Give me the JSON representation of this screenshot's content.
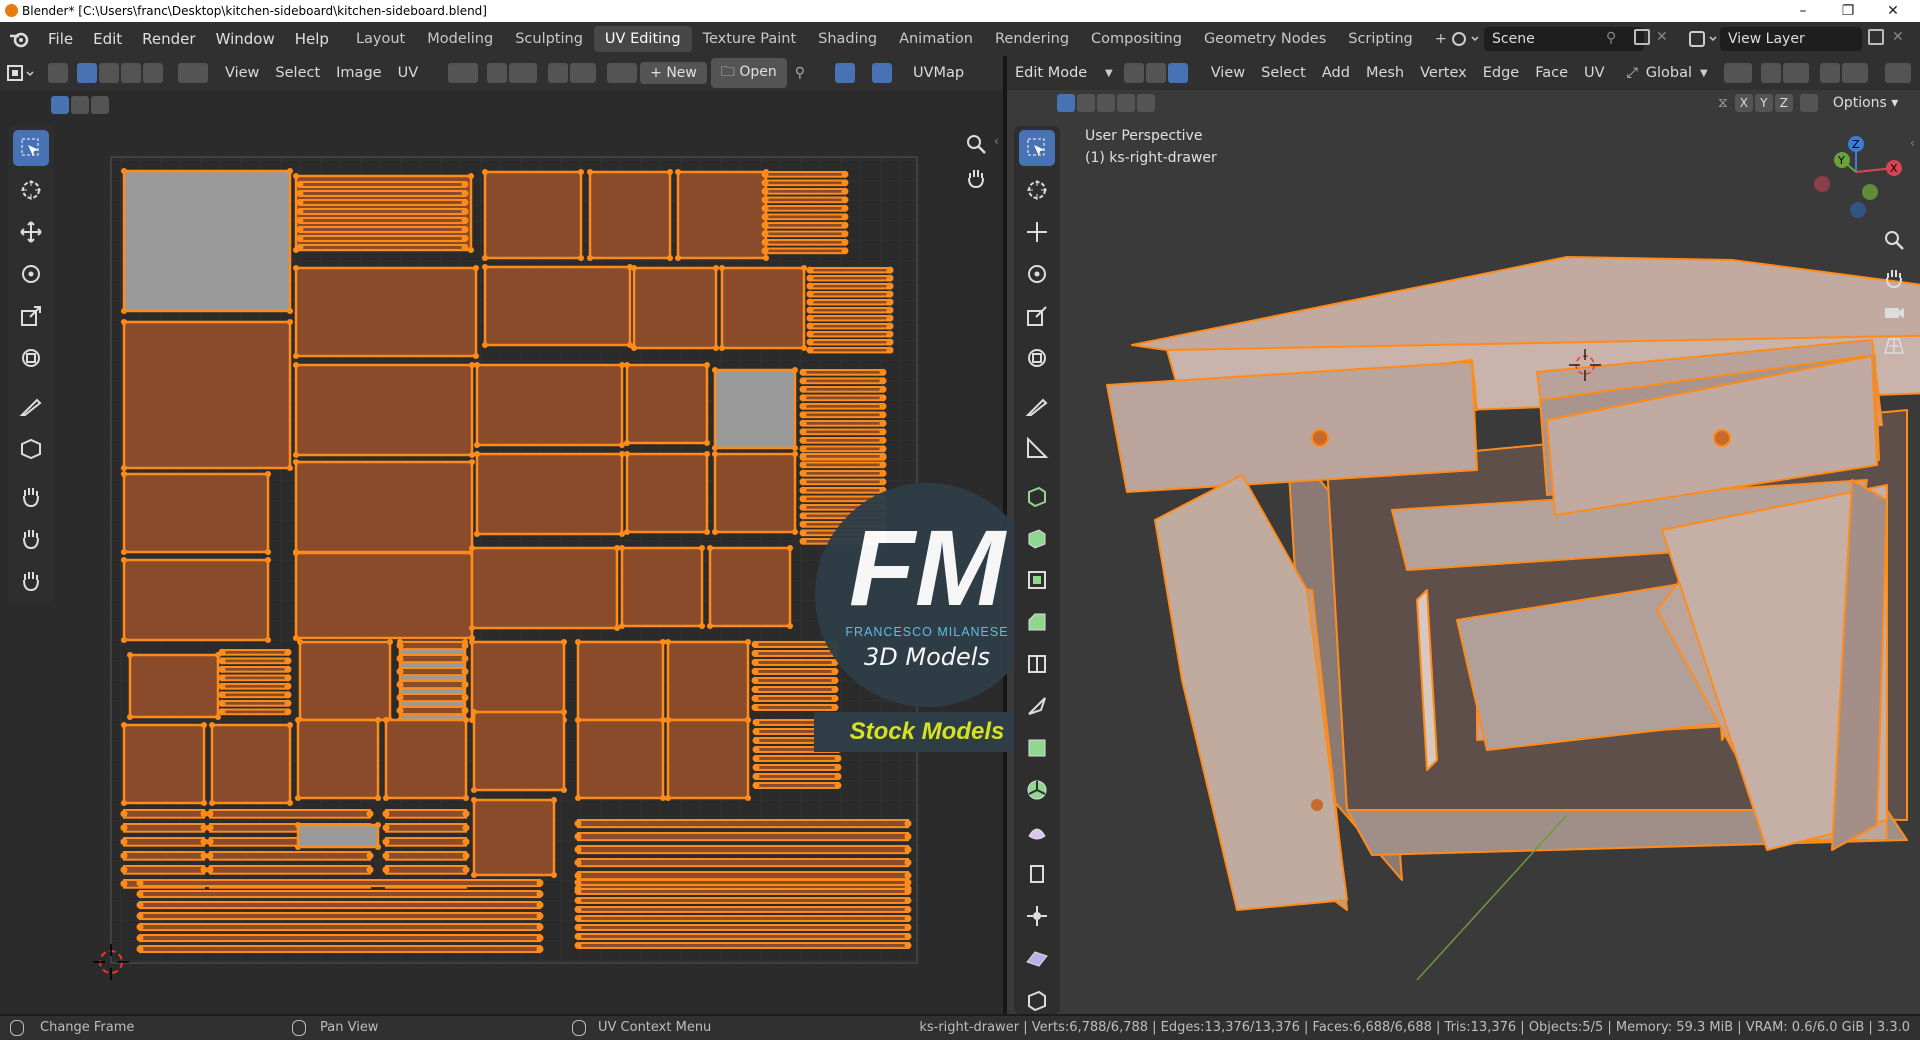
{
  "window": {
    "title": "Blender* [C:\\Users\\franc\\Desktop\\kitchen-sideboard\\kitchen-sideboard.blend]",
    "minimize": "–",
    "maximize": "❐",
    "close": "✕"
  },
  "menu": [
    "File",
    "Edit",
    "Render",
    "Window",
    "Help"
  ],
  "workspaces": [
    "Layout",
    "Modeling",
    "Sculpting",
    "UV Editing",
    "Texture Paint",
    "Shading",
    "Animation",
    "Rendering",
    "Compositing",
    "Geometry Nodes",
    "Scripting"
  ],
  "active_workspace": "UV Editing",
  "scene": {
    "label": "Scene"
  },
  "view_layer": {
    "label": "View Layer"
  },
  "uv_editor": {
    "menus": [
      "View",
      "Select",
      "Image",
      "UV"
    ],
    "new_label": "New",
    "open_label": "Open",
    "uvmap_label": "UVMap"
  },
  "viewport": {
    "mode_label": "Edit Mode",
    "menus": [
      "View",
      "Select",
      "Add",
      "Mesh",
      "Vertex",
      "Edge",
      "Face",
      "UV"
    ],
    "transform_orientation": "Global",
    "axes": [
      "X",
      "Y",
      "Z"
    ],
    "options_label": "Options",
    "overlay_line1": "User Perspective",
    "overlay_line2": "(1) ks-right-drawer"
  },
  "watermark": {
    "logo_text": "FM",
    "brand": "FRANCESCO MILANESE",
    "line": "3D Models",
    "banner": "Stock Models"
  },
  "statusbar": {
    "change_frame": "Change Frame",
    "pan_view": "Pan View",
    "context_menu": "UV Context Menu",
    "stats": "ks-right-drawer | Verts:6,788/6,788 | Edges:13,376/13,376 | Faces:6,688/6,688 | Tris:13,376 | Objects:5/5 | Memory: 59.3 MiB | VRAM: 0.6/6.0 GiB | 3.3.0"
  },
  "colors": {
    "accent": "#4772b3",
    "selection": "#ff8c1a",
    "uv_fill": "#8a4b2b",
    "unselected_face": "#9a9a9a",
    "panel_bg": "#2b2b2b"
  }
}
